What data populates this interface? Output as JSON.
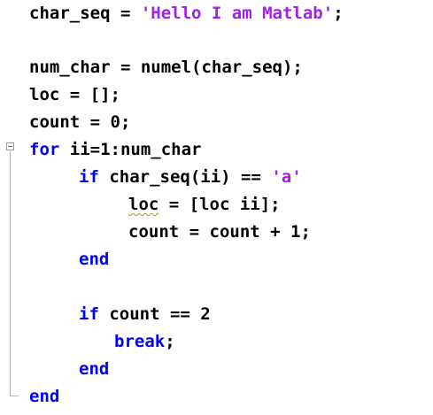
{
  "code": {
    "l1": {
      "var": "char_seq",
      "op": " = ",
      "str": "'Hello I am Matlab'",
      "end": ";"
    },
    "l2": {
      "text": "num_char = numel(char_seq);"
    },
    "l3": {
      "text": "loc = [];"
    },
    "l4": {
      "text": "count = 0;"
    },
    "l5": {
      "kw": "for",
      "rest": " ii=1:num_char"
    },
    "l6": {
      "kw": "if",
      "mid": " char_seq(ii) == ",
      "str": "'a'"
    },
    "l7": {
      "var": "loc",
      "rest": " = [loc ii];"
    },
    "l8": {
      "text": "count = count + 1;"
    },
    "l9": {
      "kw": "end"
    },
    "l10": {
      "kw": "if",
      "rest": " count == 2"
    },
    "l11": {
      "kw": "break",
      "rest": ";"
    },
    "l12": {
      "kw": "end"
    },
    "l13": {
      "kw": "end"
    }
  },
  "colors": {
    "keyword": "#0000ff",
    "string": "#a020f0",
    "text": "#000000",
    "warning_underline": "#d48a00"
  },
  "icons": {
    "fold": "collapse-minus-icon"
  }
}
